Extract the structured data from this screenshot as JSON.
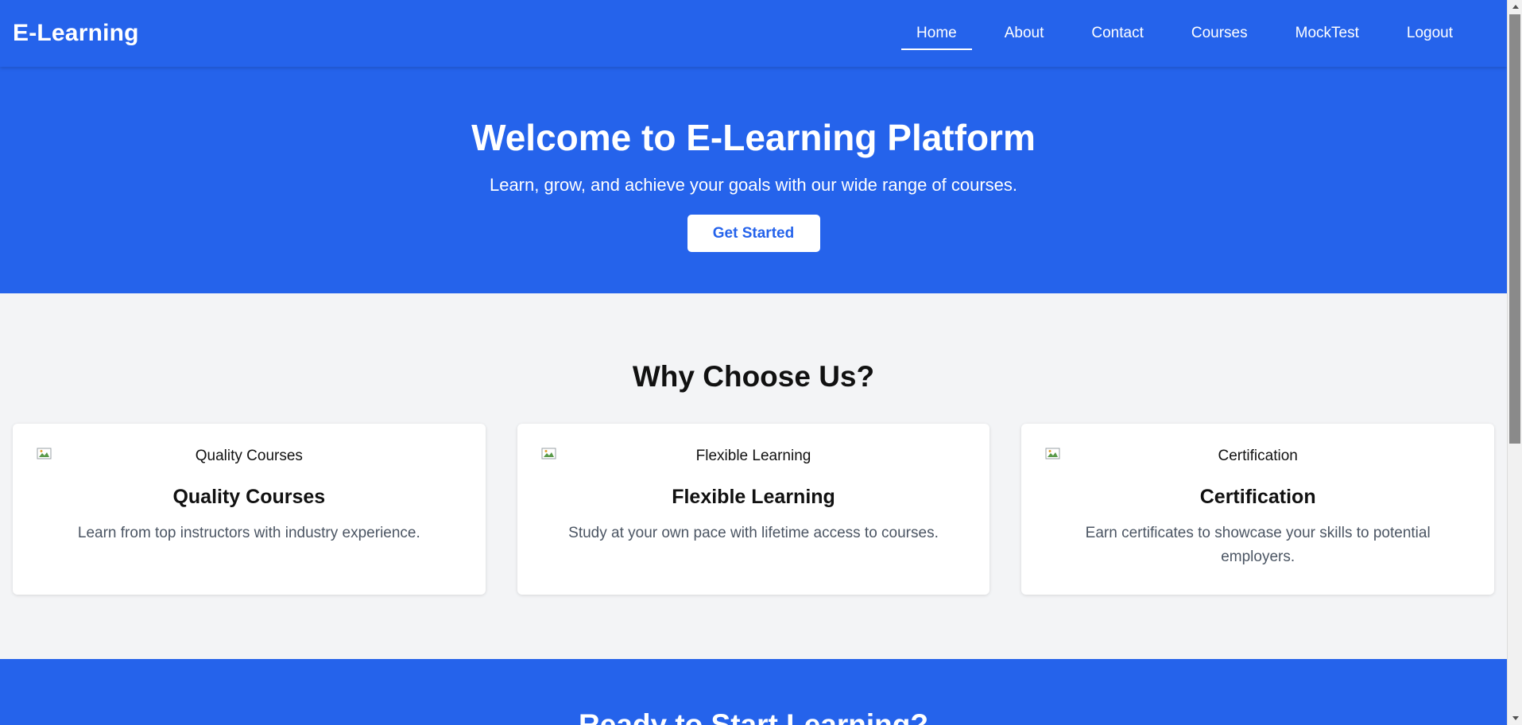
{
  "brand": "E-Learning",
  "nav": {
    "items": [
      {
        "label": "Home",
        "active": true
      },
      {
        "label": "About",
        "active": false
      },
      {
        "label": "Contact",
        "active": false
      },
      {
        "label": "Courses",
        "active": false
      },
      {
        "label": "MockTest",
        "active": false
      },
      {
        "label": "Logout",
        "active": false
      }
    ]
  },
  "hero": {
    "title": "Welcome to E-Learning Platform",
    "subtitle": "Learn, grow, and achieve your goals with our wide range of courses.",
    "cta_label": "Get Started"
  },
  "features": {
    "title": "Why Choose Us?",
    "cards": [
      {
        "img_alt": "Quality Courses",
        "title": "Quality Courses",
        "text": "Learn from top instructors with industry experience."
      },
      {
        "img_alt": "Flexible Learning",
        "title": "Flexible Learning",
        "text": "Study at your own pace with lifetime access to courses."
      },
      {
        "img_alt": "Certification",
        "title": "Certification",
        "text": "Earn certificates to showcase your skills to potential employers."
      }
    ]
  },
  "cta_section": {
    "title": "Ready to Start Learning?"
  },
  "colors": {
    "primary": "#2563eb",
    "background": "#f3f4f6",
    "card": "#ffffff",
    "muted_text": "#4b5563"
  },
  "icons": {
    "broken_image": "broken-image-icon",
    "scroll_up": "scroll-up-arrow-icon",
    "scroll_down": "scroll-down-arrow-icon"
  }
}
